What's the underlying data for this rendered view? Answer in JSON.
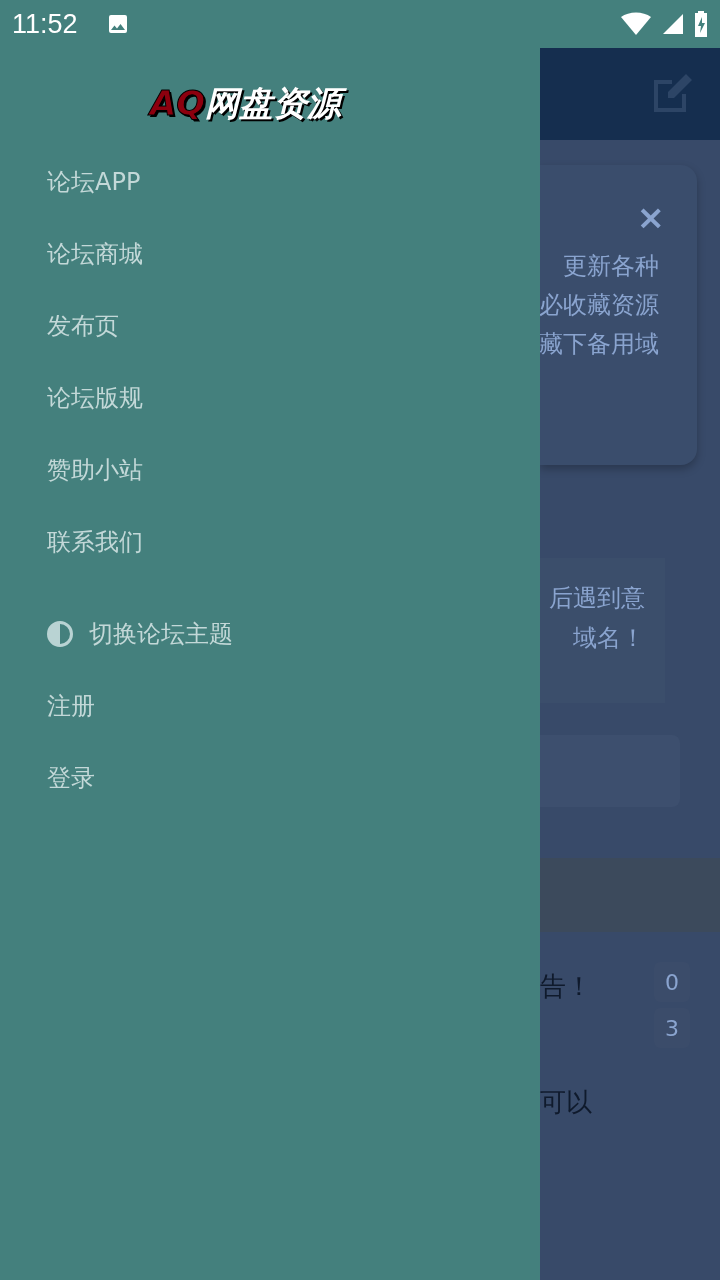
{
  "status_bar": {
    "time": "11:52"
  },
  "drawer": {
    "logo": {
      "prefix": "AQ",
      "name": "网盘资源"
    },
    "items": [
      {
        "label": "论坛APP",
        "kind": "link"
      },
      {
        "label": "论坛商城",
        "kind": "link"
      },
      {
        "label": "发布页",
        "kind": "link"
      },
      {
        "label": "论坛版规",
        "kind": "link"
      },
      {
        "label": "赞助小站",
        "kind": "link"
      },
      {
        "label": "联系我们",
        "kind": "link"
      },
      {
        "label": "切换论坛主题",
        "kind": "theme"
      },
      {
        "label": "注册",
        "kind": "link"
      },
      {
        "label": "登录",
        "kind": "link"
      }
    ]
  },
  "background_page": {
    "notice_card": {
      "close": "×",
      "lines": [
        "更新各种",
        "必收藏资源",
        "藏下备用域"
      ]
    },
    "tip_card": {
      "lines": [
        "后遇到意",
        "域名！"
      ]
    },
    "rows": [
      {
        "title": "告！",
        "counts": [
          "0",
          "3"
        ]
      },
      {
        "title": "可以",
        "counts": []
      }
    ]
  }
}
